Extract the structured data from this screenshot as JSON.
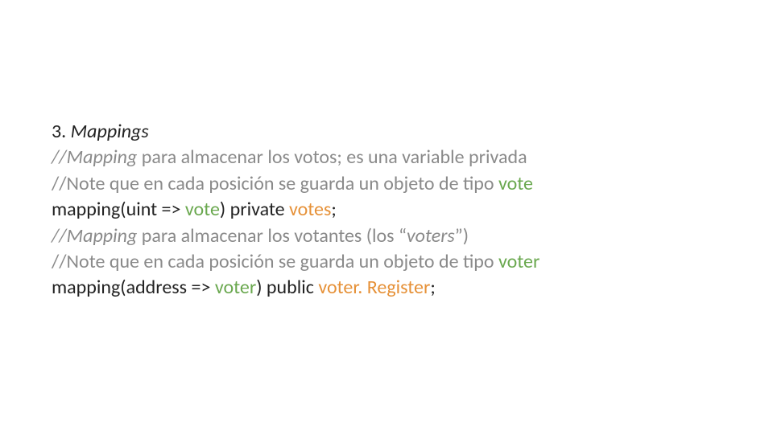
{
  "slide": {
    "l1": {
      "num": "3. ",
      "title": "Mappings"
    },
    "l2": {
      "c1": "//Mapping ",
      "c2": "para almacenar los votos; es una variable privada"
    },
    "l3": {
      "c1": "//Note que en cada posición se guarda un objeto de tipo ",
      "c2": "vote"
    },
    "l4": {
      "c1": "mapping(uint => ",
      "c2": "vote",
      "c3": ") private ",
      "c4": "votes",
      "c5": ";"
    },
    "l5": {
      "c1": "//Mapping ",
      "c2": "para almacenar los votantes (los “",
      "c3": "voters",
      "c4": "”)"
    },
    "l6": {
      "c1": "//Note que en cada posición se guarda un objeto de tipo ",
      "c2": "voter"
    },
    "l7": {
      "c1": "mapping(address => ",
      "c2": "voter",
      "c3": ") public ",
      "c4": "voter. Register",
      "c5": ";"
    }
  }
}
